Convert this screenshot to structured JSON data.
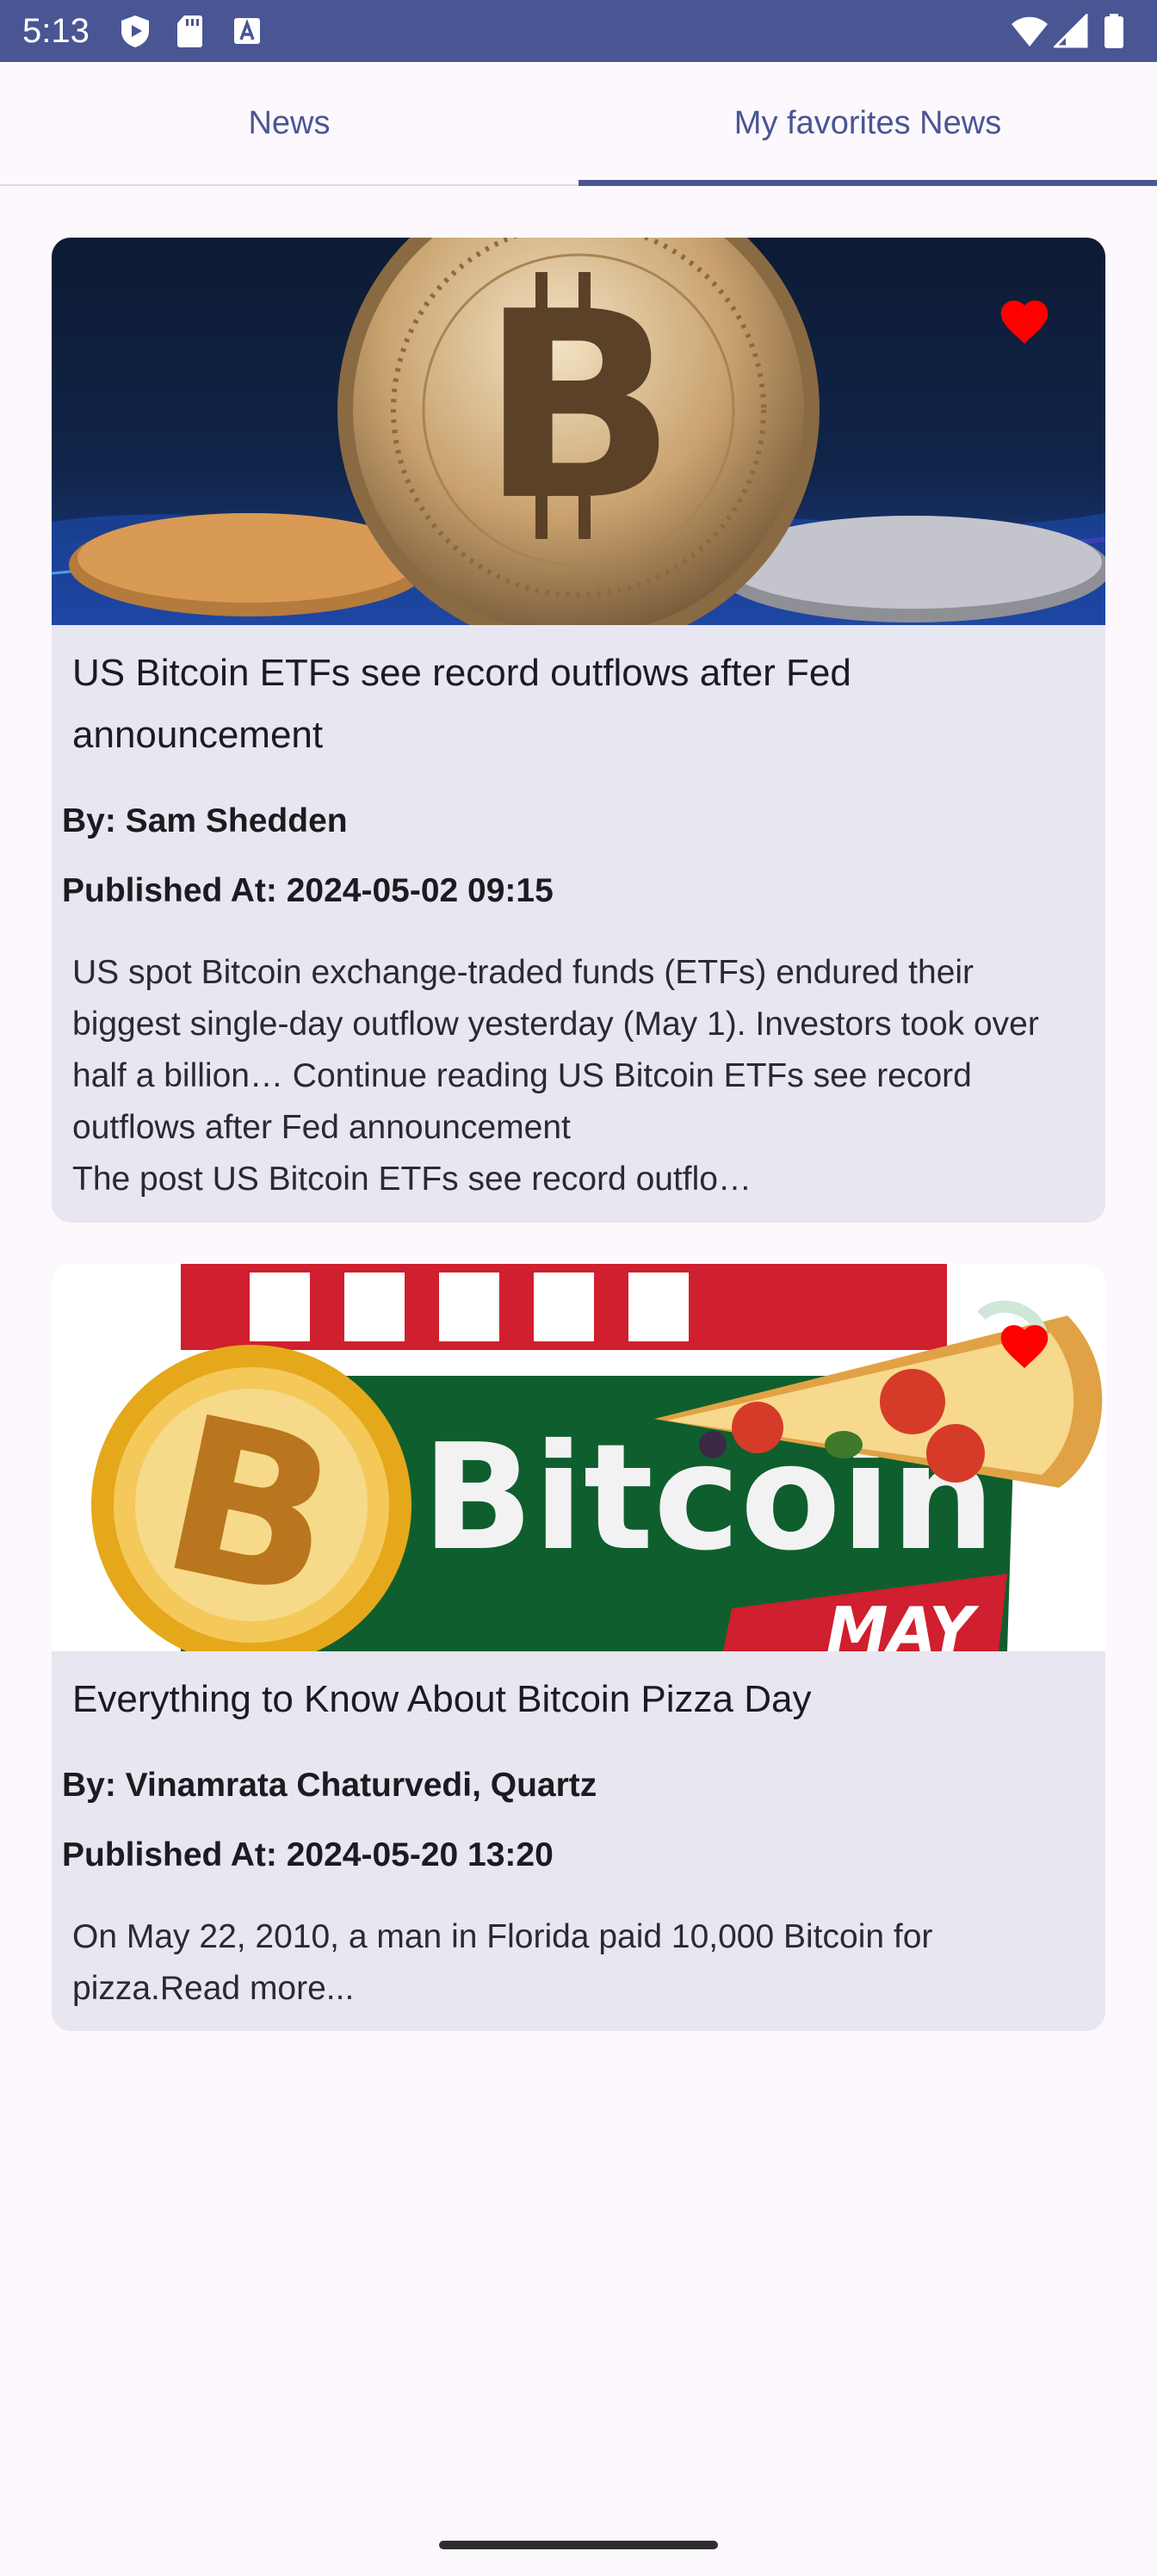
{
  "status_bar": {
    "time": "5:13",
    "left_icons": [
      "play-protect-icon",
      "sd-card-icon",
      "font-a-icon"
    ],
    "right_icons": [
      "wifi-icon",
      "cell-signal-icon",
      "battery-icon"
    ],
    "background": "#4A5594"
  },
  "tabs": [
    {
      "label": "News",
      "selected": false
    },
    {
      "label": "My favorites News",
      "selected": true
    }
  ],
  "accent_color": "#4A5594",
  "articles": [
    {
      "image": "bitcoin-coin-image",
      "favorite": true,
      "favorite_icon": "heart-icon",
      "title": "US Bitcoin ETFs see record outflows after Fed announcement",
      "author": "By: Sam Shedden",
      "published": "Published At: 2024-05-02 09:15",
      "description": "US spot Bitcoin exchange-traded funds (ETFs) endured their biggest single-day outflow yesterday (May 1). Investors took over half a billion… Continue reading US Bitcoin ETFs see record outflows after Fed announcement\nThe post US Bitcoin ETFs see record outflo…"
    },
    {
      "image": "bitcoin-pizza-day-image",
      "image_text": "Bitcoin",
      "image_text_secondary": "MAY",
      "favorite": true,
      "favorite_icon": "heart-icon",
      "title": "Everything to Know About Bitcoin Pizza Day",
      "author": "By: Vinamrata Chaturvedi, Quartz",
      "published": "Published At: 2024-05-20 13:20",
      "description": "On May 22, 2010, a man in Florida paid 10,000 Bitcoin for pizza.Read more..."
    }
  ],
  "favorite_color": "#FF0000"
}
